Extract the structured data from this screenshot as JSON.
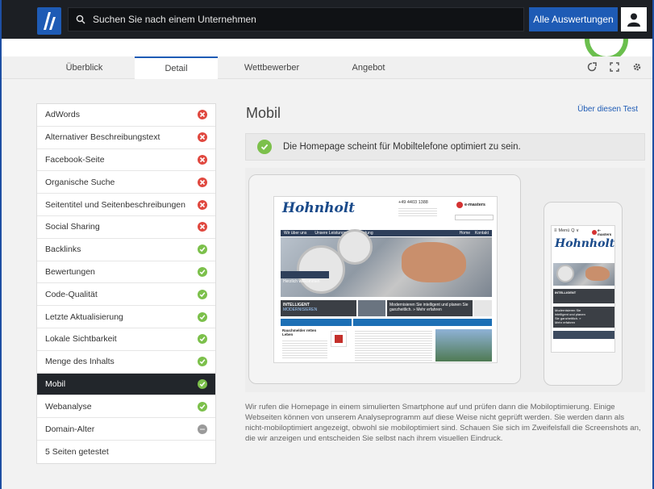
{
  "topbar": {
    "search_placeholder": "Suchen Sie nach einem Unternehmen",
    "all_reports_label": "Alle Auswertungen"
  },
  "tabs": [
    {
      "label": "Überblick"
    },
    {
      "label": "Detail"
    },
    {
      "label": "Wettbewerber"
    },
    {
      "label": "Angebot"
    }
  ],
  "sidebar": {
    "items": [
      {
        "label": "AdWords",
        "status": "bad"
      },
      {
        "label": "Alternativer Beschreibungstext",
        "status": "bad"
      },
      {
        "label": "Facebook-Seite",
        "status": "bad"
      },
      {
        "label": "Organische Suche",
        "status": "bad"
      },
      {
        "label": "Seitentitel und Seitenbeschreibungen",
        "status": "bad"
      },
      {
        "label": "Social Sharing",
        "status": "bad"
      },
      {
        "label": "Backlinks",
        "status": "good"
      },
      {
        "label": "Bewertungen",
        "status": "good"
      },
      {
        "label": "Code-Qualität",
        "status": "good"
      },
      {
        "label": "Letzte Aktualisierung",
        "status": "good"
      },
      {
        "label": "Lokale Sichtbarkeit",
        "status": "good"
      },
      {
        "label": "Menge des Inhalts",
        "status": "good"
      },
      {
        "label": "Mobil",
        "status": "good"
      },
      {
        "label": "Webanalyse",
        "status": "good"
      },
      {
        "label": "Domain-Alter",
        "status": "neutral"
      },
      {
        "label": "5 Seiten getestet",
        "status": "none"
      }
    ]
  },
  "main": {
    "title": "Mobil",
    "about_link": "Über diesen Test",
    "result_message": "Die Homepage scheint für Mobiltelefone optimiert zu sein.",
    "description": "Wir rufen die Homepage in einem simulierten Smartphone auf und prüfen dann die Mobiloptimierung. Einige Webseiten können von unserem Analyseprogramm auf diese Weise nicht geprüft werden. Sie werden dann als nicht-mobiloptimiert angezeigt, obwohl sie mobiloptimiert sind. Schauen Sie sich im Zweifelsfall die Screenshots an, die wir anzeigen und entscheiden Sie selbst nach ihrem visuellen Eindruck."
  },
  "screenshot": {
    "site_logo": "Hohnholt",
    "logo_small": "ELEKTRO",
    "phone": "+49 4403 1388",
    "partner": "e-masters",
    "nav_items": [
      "Wir über uns",
      "Unsere Leistungen",
      "Beratung"
    ],
    "nav_right": [
      "Home",
      "Kontakt"
    ],
    "welcome": "Herzlich willkommen",
    "tile_intelligent": "INTELLIGENT",
    "tile_modern": "MODERNISIEREN",
    "tile_text": "Modernisieren Sie intelligent und planen Sie ganzheitlich. » Mehr erfahren",
    "section_left": "Für Ihre Sicherheit",
    "section_right": "Als Elektro-Profi garantieren wir Ihnen beste Qualität.",
    "rauchmelder": "Rauchmelder retten Leben",
    "mobile_menu": "Menü",
    "mobile_section": "Für Ihre Sicherheit"
  }
}
